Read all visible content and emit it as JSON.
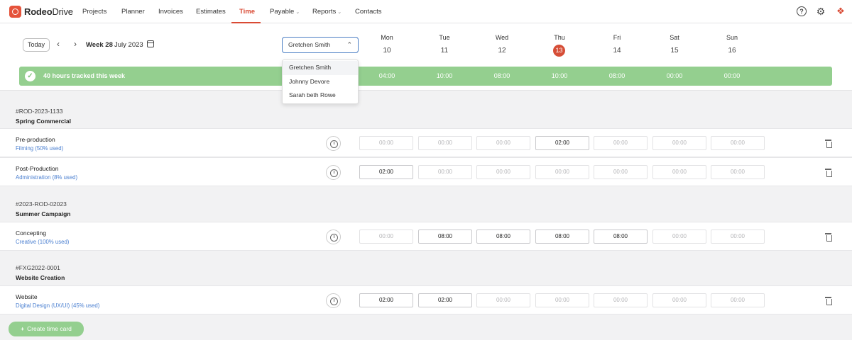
{
  "app": {
    "brand_bold": "Rodeo",
    "brand_light": "Drive"
  },
  "nav": {
    "projects": "Projects",
    "planner": "Planner",
    "invoices": "Invoices",
    "estimates": "Estimates",
    "time": "Time",
    "payable": "Payable",
    "reports": "Reports",
    "contacts": "Contacts"
  },
  "week": {
    "today_label": "Today",
    "week_label": "Week 28",
    "month_label": "July 2023",
    "person_select": "Gretchen Smith",
    "days": [
      {
        "name": "Mon",
        "num": "10",
        "total": "04:00"
      },
      {
        "name": "Tue",
        "num": "11",
        "total": "10:00"
      },
      {
        "name": "Wed",
        "num": "12",
        "total": "08:00"
      },
      {
        "name": "Thu",
        "num": "13",
        "total": "10:00"
      },
      {
        "name": "Fri",
        "num": "14",
        "total": "08:00"
      },
      {
        "name": "Sat",
        "num": "15",
        "total": "00:00"
      },
      {
        "name": "Sun",
        "num": "16",
        "total": "00:00"
      }
    ],
    "hours_tracked": "40 hours tracked this week"
  },
  "dropdown": {
    "options": [
      "Gretchen Smith",
      "Johnny Devore",
      "Sarah beth Rowe"
    ]
  },
  "projects": [
    {
      "code": "#ROD-2023-1133",
      "name": "Spring Commercial",
      "tasks": [
        {
          "name": "Pre-production",
          "sub": "Filming (50% used)",
          "cells": [
            "00:00",
            "00:00",
            "00:00",
            "02:00",
            "00:00",
            "00:00",
            "00:00"
          ]
        },
        {
          "name": "Post-Production",
          "sub": "Administration (8% used)",
          "cells": [
            "02:00",
            "00:00",
            "00:00",
            "00:00",
            "00:00",
            "00:00",
            "00:00"
          ]
        }
      ]
    },
    {
      "code": "#2023-ROD-02023",
      "name": "Summer Campaign",
      "tasks": [
        {
          "name": "Concepting",
          "sub": "Creative (100% used)",
          "cells": [
            "00:00",
            "08:00",
            "08:00",
            "08:00",
            "08:00",
            "00:00",
            "00:00"
          ]
        }
      ]
    },
    {
      "code": "#FXG2022-0001",
      "name": "Website Creation",
      "tasks": [
        {
          "name": "Website",
          "sub": "Digital Design (UX/UI) (45% used)",
          "cells": [
            "02:00",
            "02:00",
            "00:00",
            "00:00",
            "00:00",
            "00:00",
            "00:00"
          ]
        }
      ]
    }
  ],
  "create_button": "Create time card",
  "colors": {
    "accent": "#d94a34",
    "green": "#94cf8f",
    "link": "#4a7fd0"
  }
}
